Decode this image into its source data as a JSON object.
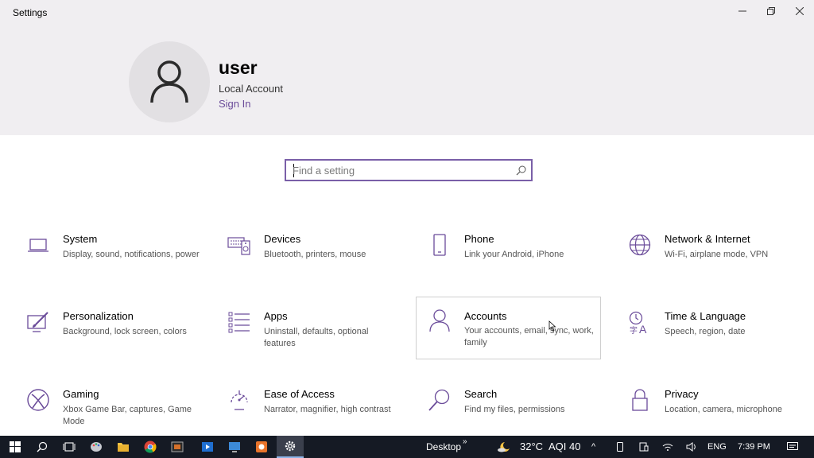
{
  "window": {
    "title": "Settings"
  },
  "profile": {
    "name": "user",
    "account_type": "Local Account",
    "sign_in": "Sign In"
  },
  "search": {
    "placeholder": "Find a setting"
  },
  "tiles": [
    {
      "name": "System",
      "desc": "Display, sound, notifications, power",
      "icon": "laptop-icon"
    },
    {
      "name": "Devices",
      "desc": "Bluetooth, printers, mouse",
      "icon": "keyboard-speaker-icon"
    },
    {
      "name": "Phone",
      "desc": "Link your Android, iPhone",
      "icon": "phone-icon"
    },
    {
      "name": "Network & Internet",
      "desc": "Wi-Fi, airplane mode, VPN",
      "icon": "globe-icon"
    },
    {
      "name": "Personalization",
      "desc": "Background, lock screen, colors",
      "icon": "brush-icon"
    },
    {
      "name": "Apps",
      "desc": "Uninstall, defaults, optional features",
      "icon": "apps-list-icon"
    },
    {
      "name": "Accounts",
      "desc": "Your accounts, email, sync, work, family",
      "icon": "person-icon"
    },
    {
      "name": "Time & Language",
      "desc": "Speech, region, date",
      "icon": "time-language-icon"
    },
    {
      "name": "Gaming",
      "desc": "Xbox Game Bar, captures, Game Mode",
      "icon": "xbox-icon"
    },
    {
      "name": "Ease of Access",
      "desc": "Narrator, magnifier, high contrast",
      "icon": "ease-of-access-icon"
    },
    {
      "name": "Search",
      "desc": "Find my files, permissions",
      "icon": "search-icon"
    },
    {
      "name": "Privacy",
      "desc": "Location, camera, microphone",
      "icon": "lock-icon"
    }
  ],
  "taskbar": {
    "desktop_label": "Desktop",
    "weather": "32°C",
    "aqi": "AQI 40",
    "language": "ENG",
    "time": "7:39 PM"
  },
  "colors": {
    "accent": "#6b4c9a",
    "header_bg": "#f0eef1",
    "taskbar_bg": "#151a24"
  }
}
